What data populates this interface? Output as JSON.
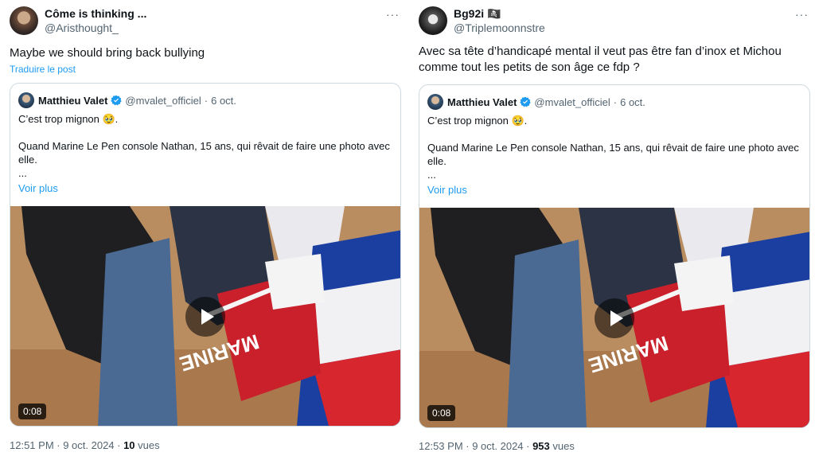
{
  "tweets": [
    {
      "author": {
        "display_name": "Côme is thinking ...",
        "handle": "@Aristhought_"
      },
      "more_label": "···",
      "text": "Maybe we should bring back bullying",
      "translate_label": "Traduire le post",
      "quote": {
        "author": {
          "display_name": "Matthieu Valet",
          "handle": "@mvalet_officiel",
          "date": "6 oct."
        },
        "text": "C’est trop mignon 🥹.\n\nQuand Marine Le Pen console Nathan, 15 ans, qui rêvait de faire une photo avec elle.\n...",
        "see_more_label": "Voir plus",
        "video_duration": "0:08",
        "flag_text": "MARINE"
      },
      "time": "12:51 PM · 9 oct. 2024 · ",
      "views_count": "10",
      "views_label": " vues"
    },
    {
      "author": {
        "display_name": "Bg92i 🏴‍☠️",
        "handle": "@Triplemoonnstre"
      },
      "more_label": "···",
      "text": "Avec sa tête d’handicapé mental il veut pas être fan d’inox et Michou comme tout les petits de son âge ce fdp ?",
      "quote": {
        "author": {
          "display_name": "Matthieu Valet",
          "handle": "@mvalet_officiel",
          "date": "6 oct."
        },
        "text": "C’est trop mignon 🥹.\n\nQuand Marine Le Pen console Nathan, 15 ans, qui rêvait de faire une photo avec elle.\n...",
        "see_more_label": "Voir plus",
        "video_duration": "0:08",
        "flag_text": "MARINE"
      },
      "time": "12:53 PM · 9 oct. 2024 · ",
      "views_count": "953",
      "views_label": " vues"
    }
  ],
  "colors": {
    "link": "#1d9bf0",
    "verified": "#1d9bf0",
    "secondary_text": "#536471"
  },
  "icons": [
    "avatar",
    "more-icon",
    "verified-icon",
    "play-icon"
  ]
}
